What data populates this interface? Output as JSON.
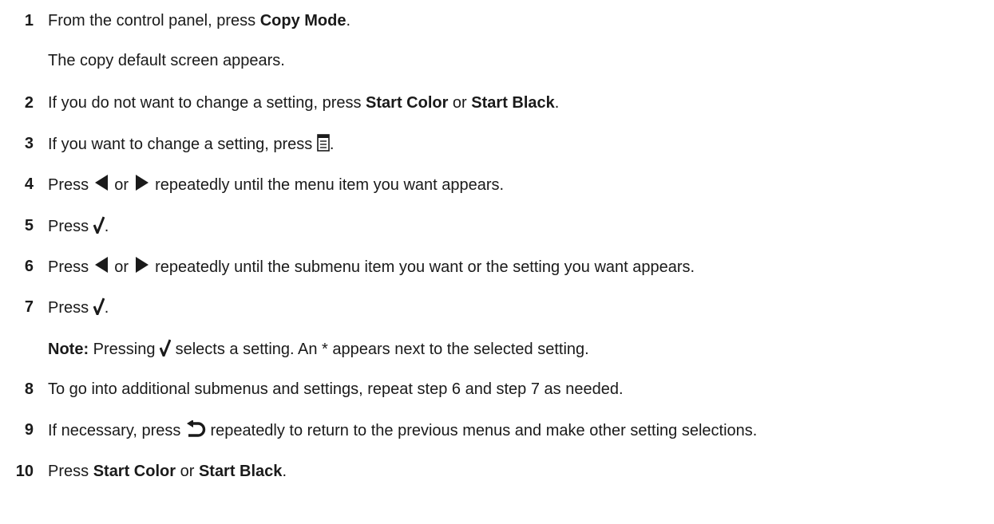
{
  "steps": [
    {
      "num": "1",
      "pre": "From the control panel, press ",
      "bold": "Copy Mode",
      "post": "."
    },
    {
      "sub": "The copy default screen appears."
    },
    {
      "num": "2",
      "pre": "If you do not want to change a setting, press ",
      "bold1": "Start Color",
      "mid": " or ",
      "bold2": "Start Black",
      "post": "."
    },
    {
      "num": "3",
      "pre": "If you want to change a setting, press ",
      "post": ".",
      "icon": "menu-icon"
    },
    {
      "num": "4",
      "pre": "Press ",
      "mid": " or ",
      "post": " repeatedly until the menu item you want appears.",
      "icon_left": "left-arrow-icon",
      "icon_right": "right-arrow-icon"
    },
    {
      "num": "5",
      "pre": "Press ",
      "post": ".",
      "icon": "checkmark-icon"
    },
    {
      "num": "6",
      "pre": "Press ",
      "mid": " or ",
      "post": " repeatedly until the submenu item you want or the setting you want appears.",
      "icon_left": "left-arrow-icon",
      "icon_right": "right-arrow-icon"
    },
    {
      "num": "7",
      "pre": "Press ",
      "post": ".",
      "icon": "checkmark-icon"
    },
    {
      "note_label": "Note:",
      "pre": " Pressing ",
      "post": " selects a setting. An * appears next to the selected setting.",
      "icon": "checkmark-icon"
    },
    {
      "num": "8",
      "text": "To go into additional submenus and settings, repeat step 6 and step 7 as needed."
    },
    {
      "num": "9",
      "pre": "If necessary, press ",
      "post": " repeatedly to return to the previous menus and make other setting selections.",
      "icon": "back-icon"
    },
    {
      "num": "10",
      "pre": "Press ",
      "bold1": "Start Color",
      "mid": " or ",
      "bold2": "Start Black",
      "post": "."
    }
  ]
}
